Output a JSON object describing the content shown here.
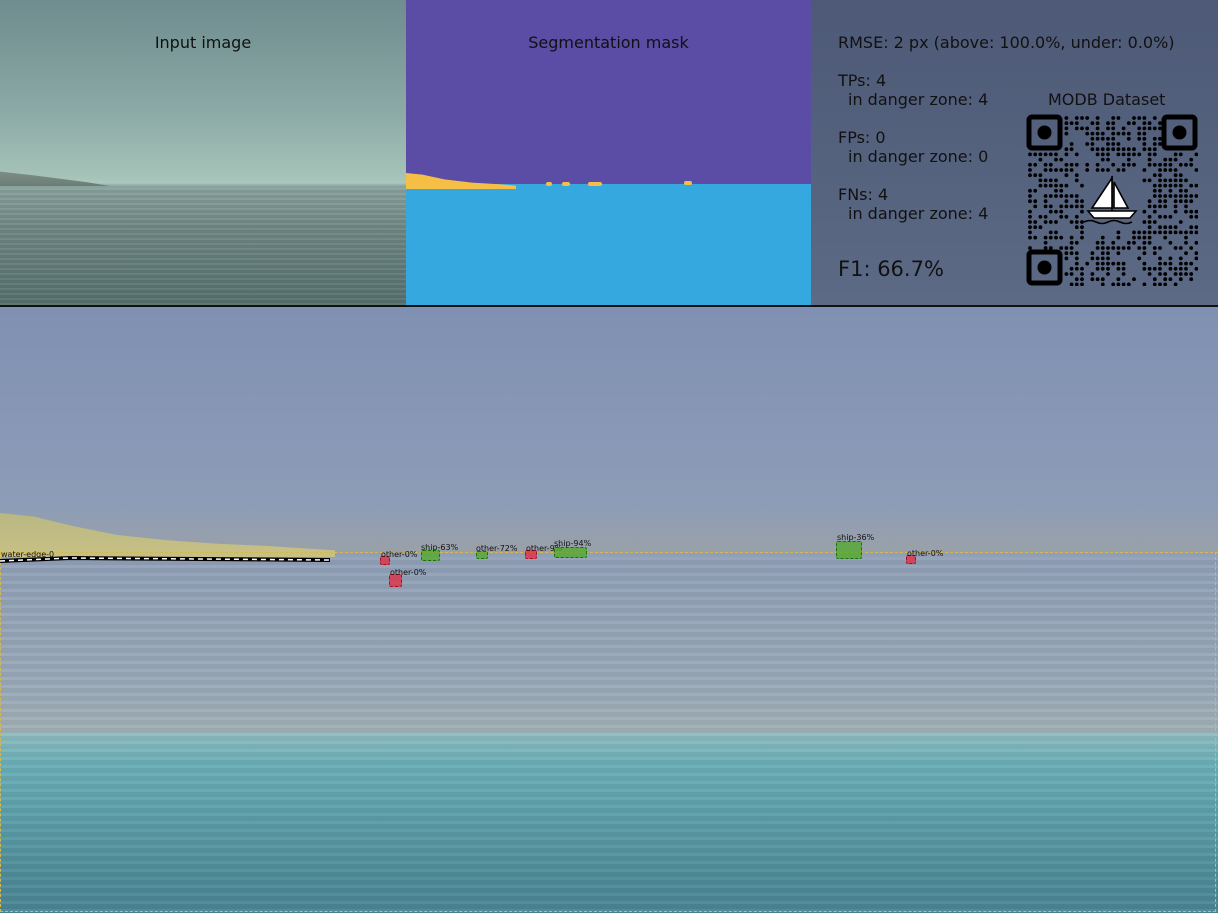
{
  "panels": {
    "input_title": "Input image",
    "mask_title": "Segmentation mask"
  },
  "stats": {
    "rmse": "RMSE: 2 px (above: 100.0%, under: 0.0%)",
    "tps": "TPs: 4",
    "tps_danger": "in danger zone: 4",
    "fps": "FPs: 0",
    "fps_danger": "in danger zone: 0",
    "fns": "FNs: 4",
    "fns_danger": "in danger zone: 4",
    "f1": "F1: 66.7%",
    "dataset": "MODB Dataset"
  },
  "scene": {
    "water_edge_label": "water-edge-0",
    "detections": [
      {
        "label": "other-0%",
        "kind": "false-negative"
      },
      {
        "label": "ship-63%",
        "kind": "true-positive"
      },
      {
        "label": "other-0%",
        "kind": "false-negative"
      },
      {
        "label": "other-72%",
        "kind": "true-positive"
      },
      {
        "label": "other-9%",
        "kind": "false-negative"
      },
      {
        "label": "ship-94%",
        "kind": "true-positive"
      },
      {
        "label": "ship-36%",
        "kind": "true-positive"
      },
      {
        "label": "other-0%",
        "kind": "false-negative"
      }
    ]
  },
  "colors": {
    "sky_mask": "#5b4ca5",
    "water_mask": "#35a8e0",
    "obstacle_mask": "#f5be45",
    "true_positive": "#50aa28",
    "false_negative": "#e6283c"
  },
  "icons": {
    "qr": "qr-code-icon",
    "sailboat": "sailboat-icon"
  }
}
